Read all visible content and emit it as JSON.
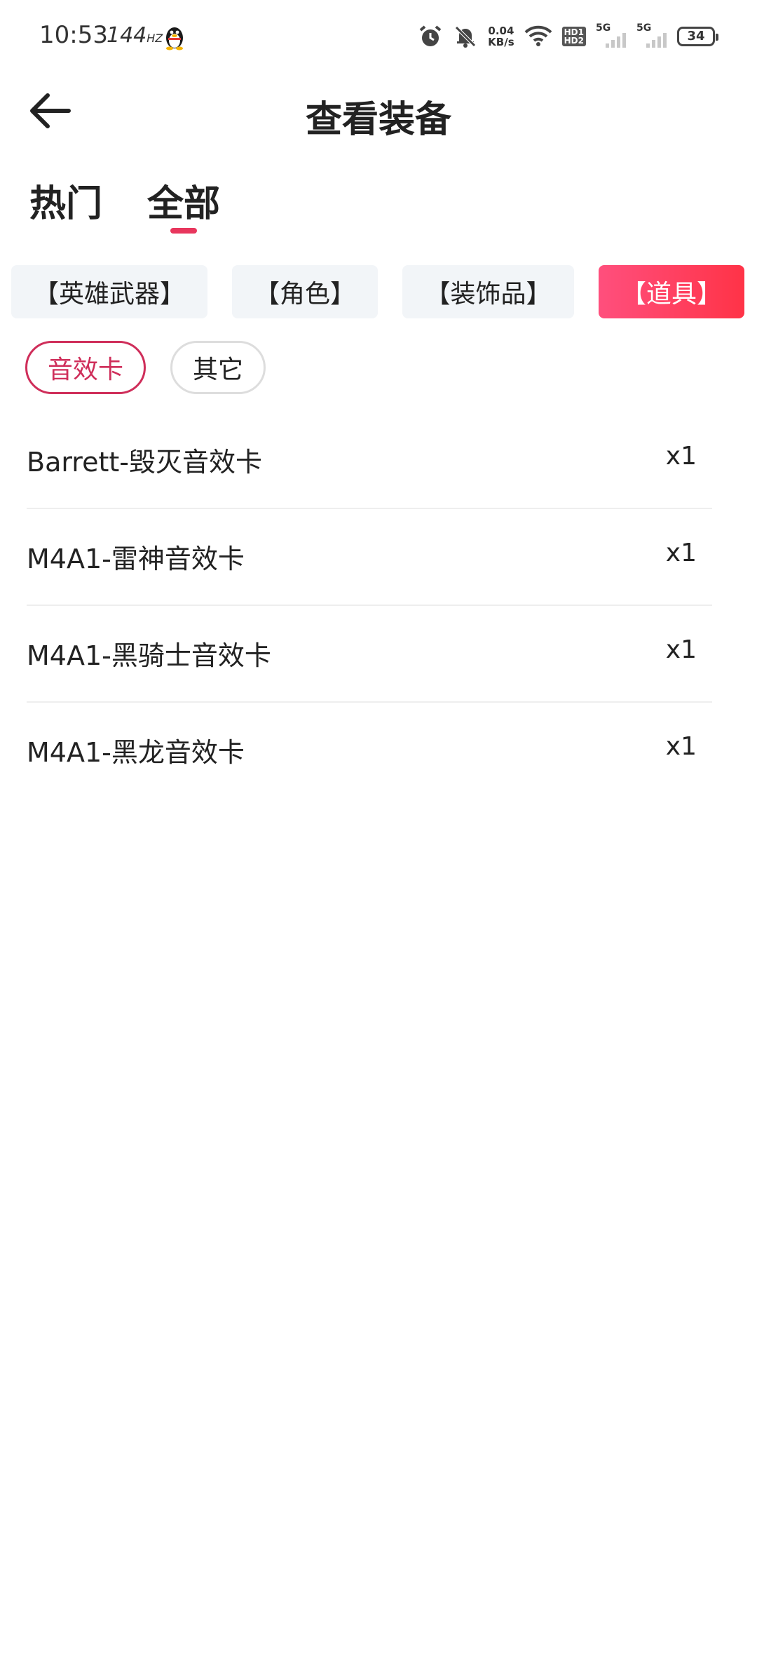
{
  "status_bar": {
    "time": "10:53",
    "refresh_rate": "144",
    "refresh_unit": "HZ",
    "net_speed_value": "0.04",
    "net_speed_unit": "KB/s",
    "hd_top": "HD1",
    "hd_bottom": "HD2",
    "sim1_label": "5G",
    "sim2_label": "5G",
    "battery": "34"
  },
  "header": {
    "title": "查看装备"
  },
  "tabs": [
    {
      "label": "热门",
      "active": false
    },
    {
      "label": "全部",
      "active": true
    }
  ],
  "categories": [
    {
      "label": "【英雄武器】",
      "active": false
    },
    {
      "label": "【角色】",
      "active": false
    },
    {
      "label": "【装饰品】",
      "active": false
    },
    {
      "label": "【道具】",
      "active": true
    }
  ],
  "sub_filters": [
    {
      "label": "音效卡",
      "active": true
    },
    {
      "label": "其它",
      "active": false
    }
  ],
  "items": [
    {
      "name": "Barrett-毁灭音效卡",
      "qty": "x1"
    },
    {
      "name": "M4A1-雷神音效卡",
      "qty": "x1"
    },
    {
      "name": "M4A1-黑骑士音效卡",
      "qty": "x1"
    },
    {
      "name": "M4A1-黑龙音效卡",
      "qty": "x1"
    }
  ],
  "colors": {
    "accent": "#e8365d",
    "active_chip_start": "#ff4f7d",
    "active_chip_end": "#ff3347",
    "chip_bg": "#f2f5f8",
    "pill_active": "#cf2e5a"
  }
}
